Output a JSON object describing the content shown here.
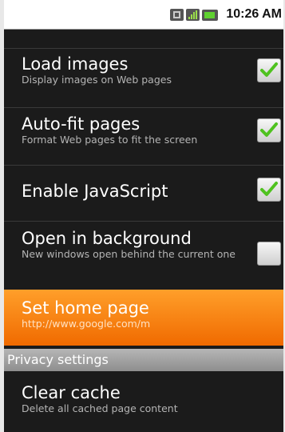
{
  "status_bar": {
    "time": "10:26 AM",
    "icons": [
      "3g-icon",
      "signal-icon",
      "battery-icon"
    ]
  },
  "settings": [
    {
      "title": "Load images",
      "summary": "Display images on Web pages",
      "checked": true
    },
    {
      "title": "Auto-fit pages",
      "summary": "Format Web pages to fit the screen",
      "checked": true
    },
    {
      "title": "Enable JavaScript",
      "summary": "",
      "checked": true
    },
    {
      "title": "Open in background",
      "summary": "New windows open behind the current one",
      "checked": false
    },
    {
      "title": "Set home page",
      "summary": "http://www.google.com/m"
    }
  ],
  "category": "Privacy settings",
  "privacy": [
    {
      "title": "Clear cache",
      "summary": "Delete all cached page content"
    }
  ],
  "colors": {
    "selected_accent": "#f57b0a",
    "check_green": "#4fc21f"
  }
}
